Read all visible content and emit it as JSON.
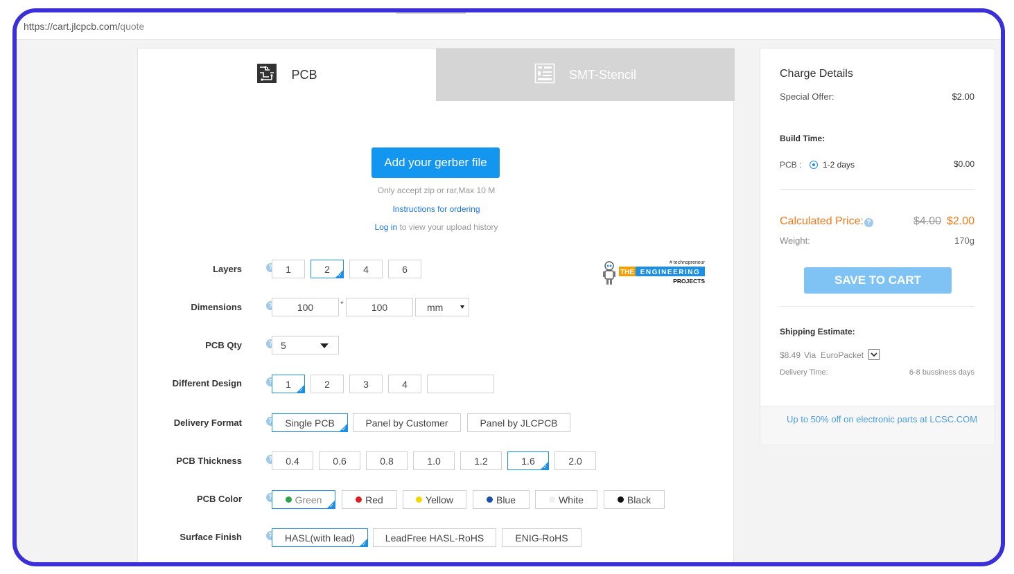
{
  "browser": {
    "url_host": "https://cart.jlcpcb.com/",
    "url_path": "quote"
  },
  "tabs": [
    {
      "label": "PCB",
      "icon": "pcb-board-icon",
      "active": true
    },
    {
      "label": "SMT-Stencil",
      "icon": "stencil-icon",
      "active": false
    }
  ],
  "upload": {
    "button_label": "Add your gerber file",
    "note": "Only accept zip or rar,Max 10 M",
    "instructions_link": "Instructions for ordering",
    "login_link": "Log in",
    "login_suffix": " to view your upload history"
  },
  "logo": {
    "tagline": "# technopreneur",
    "word1": "THE",
    "word2": "ENGINEERING",
    "word3": "PROJECTS"
  },
  "form": {
    "layers": {
      "label": "Layers",
      "options": [
        "1",
        "2",
        "4",
        "6"
      ],
      "selected": "2"
    },
    "dimensions": {
      "label": "Dimensions",
      "width": "100",
      "separator": "*",
      "height": "100",
      "unit": "mm"
    },
    "qty": {
      "label": "PCB Qty",
      "value": "5"
    },
    "different_design": {
      "label": "Different Design",
      "options": [
        "1",
        "2",
        "3",
        "4"
      ],
      "selected": "1",
      "custom": ""
    },
    "delivery_format": {
      "label": "Delivery Format",
      "options": [
        "Single PCB",
        "Panel by Customer",
        "Panel by JLCPCB"
      ],
      "selected": "Single PCB"
    },
    "thickness": {
      "label": "PCB Thickness",
      "options": [
        "0.4",
        "0.6",
        "0.8",
        "1.0",
        "1.2",
        "1.6",
        "2.0"
      ],
      "selected": "1.6"
    },
    "color": {
      "label": "PCB Color",
      "options": [
        {
          "name": "Green",
          "color": "#2fa34a"
        },
        {
          "name": "Red",
          "color": "#e02020"
        },
        {
          "name": "Yellow",
          "color": "#f5d800"
        },
        {
          "name": "Blue",
          "color": "#1c4fa8"
        },
        {
          "name": "White",
          "color": "#eeeeee"
        },
        {
          "name": "Black",
          "color": "#111111"
        }
      ],
      "selected": "Green"
    },
    "surface_finish": {
      "label": "Surface Finish",
      "options": [
        "HASL(with lead)",
        "LeadFree HASL-RoHS",
        "ENIG-RoHS"
      ],
      "selected": "HASL(with lead)"
    }
  },
  "charges": {
    "title": "Charge Details",
    "special_offer_label": "Special Offer:",
    "special_offer_value": "$2.00",
    "build_time_label": "Build Time:",
    "pcb_label": "PCB :",
    "pcb_days": "1-2 days",
    "pcb_price": "$0.00",
    "calc_label": "Calculated Price:",
    "old_price": "$4.00",
    "new_price": "$2.00",
    "weight_label": "Weight:",
    "weight_value": "170g",
    "save_label": "SAVE TO CART",
    "shipping_label": "Shipping Estimate:",
    "shipping_price": "$8.49",
    "shipping_via": "Via",
    "shipping_method": "EuroPacket",
    "delivery_label": "Delivery Time:",
    "delivery_value": "6-8 bussiness days",
    "promo": "Up to 50% off on electronic parts at LCSC.COM"
  },
  "colors": {
    "accent": "#1296f0",
    "price_orange": "#f07a1e",
    "frame": "#3a2fd8"
  }
}
